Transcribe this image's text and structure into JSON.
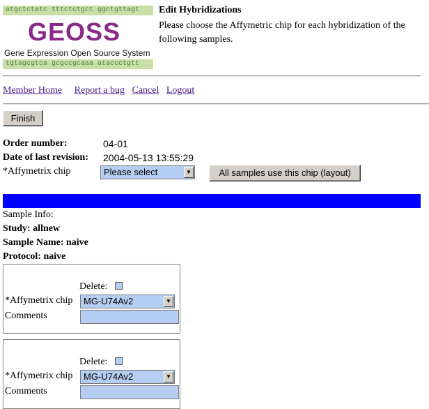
{
  "logo": {
    "seq_top": "atgctctatc tttctctgct ggctgttagt",
    "brand": "GEOSS",
    "tagline": "Gene Expression Open Source System",
    "seq_bottom": "tgtagcgtca gcgccgcaaa ataccctgtt"
  },
  "header": {
    "title": "Edit Hybridizations",
    "description": "Please choose the Affymetric chip for each hybridization of the following samples."
  },
  "nav": {
    "member_home": "Member Home",
    "report_bug": "Report a bug",
    "cancel": "Cancel",
    "logout": "Logout"
  },
  "finish_label": "Finish",
  "order": {
    "number_label": "Order number:",
    "number_value": "04-01",
    "revision_label": "Date of last revision:",
    "revision_value": "2004-05-13 13:55:29",
    "chip_label": "*Affymetrix chip",
    "chip_selected": "Please select",
    "apply_all_label": "All samples use this chip (layout)"
  },
  "colors": {
    "accent_bar": "#0000ff",
    "field_bg": "#b4cdf0",
    "logo": "#8a2a87"
  },
  "sample": {
    "info_label": "Sample Info:",
    "study": "Study: allnew",
    "name": "Sample Name: naive",
    "protocol": "Protocol: naive"
  },
  "hybridizations": [
    {
      "delete_label": "Delete:",
      "chip_label": "*Affymetrix chip",
      "chip_value": "MG-U74Av2",
      "comments_label": "Comments",
      "comments_value": ""
    },
    {
      "delete_label": "Delete:",
      "chip_label": "*Affymetrix chip",
      "chip_value": "MG-U74Av2",
      "comments_label": "Comments",
      "comments_value": ""
    }
  ]
}
